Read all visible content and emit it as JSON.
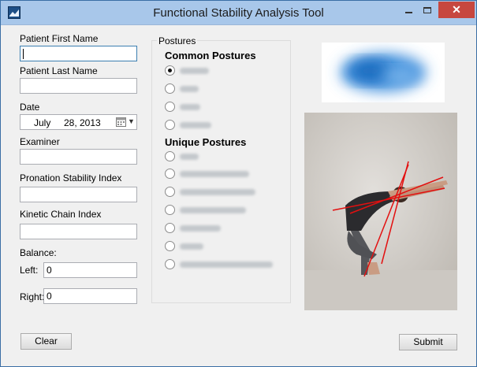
{
  "window": {
    "title": "Functional Stability Analysis Tool",
    "close_glyph": "✕"
  },
  "form": {
    "first_name": {
      "label": "Patient First Name",
      "value": ""
    },
    "last_name": {
      "label": "Patient Last Name",
      "value": ""
    },
    "date": {
      "label": "Date",
      "month": "July",
      "day": "28,",
      "year": "2013"
    },
    "examiner": {
      "label": "Examiner",
      "value": ""
    },
    "pronation": {
      "label": "Pronation Stability Index",
      "value": ""
    },
    "kinetic": {
      "label": "Kinetic Chain Index",
      "value": ""
    },
    "balance": {
      "label": "Balance:",
      "left_label": "Left:",
      "left_value": "0",
      "right_label": "Right:",
      "right_value": "0"
    }
  },
  "postures": {
    "group_title": "Postures",
    "common_heading": "Common Postures",
    "unique_heading": "Unique Postures",
    "common_selected_index": 0
  },
  "buttons": {
    "clear": "Clear",
    "submit": "Submit"
  },
  "icons": {
    "app": "app-logo-icon",
    "calendar": "calendar-icon",
    "dropdown": "chevron-down-icon"
  }
}
